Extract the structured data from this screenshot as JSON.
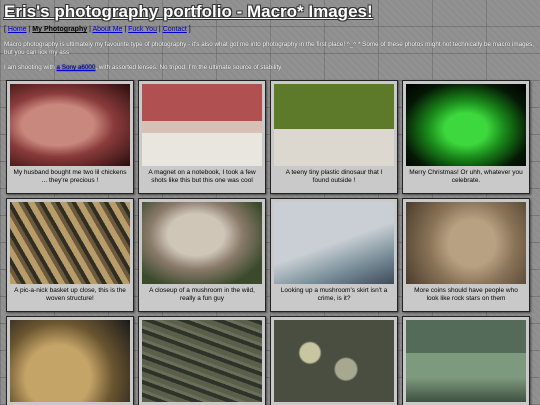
{
  "header": {
    "title": "Eris's photography portfolio - Macro* Images!"
  },
  "nav": {
    "items": [
      "Home",
      "My Photography",
      "About Me",
      "Fuck You",
      "Contact"
    ],
    "current_index": 1
  },
  "intro": {
    "text": "Macro photography is ultimately my favourite type of photography - it's also what got me into photography in the first place! ^_^ * Some of these photos might not technically be macro images, but you can lick my ass"
  },
  "shooting": {
    "prefix": "I am shooting with",
    "link": "a Sony a6000",
    "suffix": ", with assorted lenses. No tripod, I'm the ultimate source of stability."
  },
  "gallery": [
    {
      "caption": "My husband bought me two lil chickens ... they're precious !",
      "icon": "chicken-plush-photo"
    },
    {
      "caption": "A magnet on a notebook, I took a few shots like this but this one was cool",
      "icon": "magnet-notebook-photo"
    },
    {
      "caption": "A teeny tiny plastic dinosaur that I found outside !",
      "icon": "plastic-dinosaur-photo"
    },
    {
      "caption": "Merry Christmas! Or uhh, whatever you celebrate.",
      "icon": "christmas-tree-photo"
    },
    {
      "caption": "A pic-a-nick basket up close, this is the woven structure!",
      "icon": "woven-basket-photo"
    },
    {
      "caption": "A closeup of a mushroom in the wild, really a fun guy",
      "icon": "mushroom-photo"
    },
    {
      "caption": "Looking up a mushroom's skirt isn't a crime, is it?",
      "icon": "mushroom-skirt-photo"
    },
    {
      "caption": "More coins should have people who look like rock stars on them",
      "icon": "coin-photo"
    },
    {
      "caption": "",
      "icon": "quarter-coin-photo"
    },
    {
      "caption": "",
      "icon": "stone-texture-photo"
    },
    {
      "caption": "",
      "icon": "lichen-rock-photo"
    },
    {
      "caption": "",
      "icon": "chain-hook-photo"
    }
  ]
}
